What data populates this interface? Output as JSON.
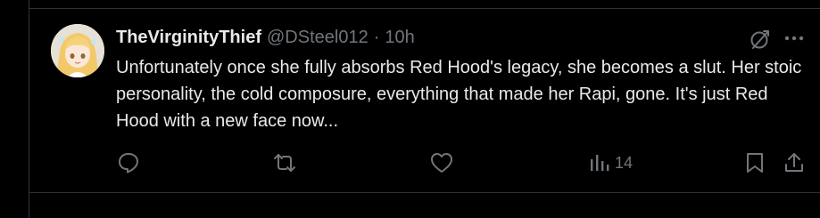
{
  "tweet": {
    "display_name": "TheVirginityThief",
    "handle": "@DSteel012",
    "separator": "·",
    "time": "10h",
    "text": "Unfortunately once she fully absorbs Red Hood's legacy, she becomes a slut. Her stoic personality, the cold composure, everything that made her Rapi, gone. It's just Red Hood with a new face now...",
    "views_count": "14",
    "more_label": "···"
  },
  "icons": {
    "grok": "grok-icon",
    "more": "more-icon",
    "reply": "reply-icon",
    "retweet": "retweet-icon",
    "like": "like-icon",
    "views": "views-icon",
    "bookmark": "bookmark-icon",
    "share": "share-icon"
  },
  "colors": {
    "background": "#000000",
    "primary_text": "#e7e9ea",
    "secondary_text": "#71767b",
    "border": "#2f3336"
  }
}
